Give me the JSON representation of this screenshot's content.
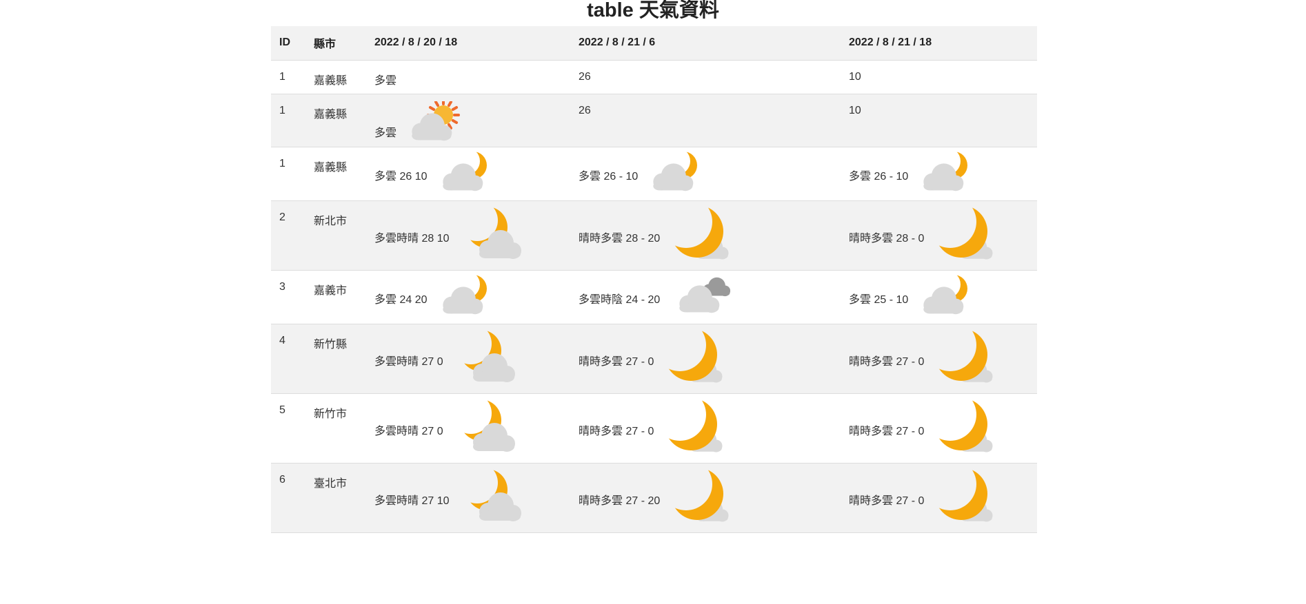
{
  "title": {
    "bold": "table",
    "rest": " 天氣資料"
  },
  "headers": [
    "ID",
    "縣市",
    "2022 / 8 / 20 / 18",
    "2022 / 8 / 21 / 6",
    "2022 / 8 / 21 / 18"
  ],
  "rows": [
    {
      "id": "1",
      "city": "嘉義縣",
      "c1": "多雲",
      "c2": "26",
      "c3": "10",
      "icons": [
        "",
        "",
        ""
      ]
    },
    {
      "id": "1",
      "city": "嘉義縣",
      "c1": "多雲",
      "c2": "26",
      "c3": "10",
      "icons": [
        "sun-behind-cloud-icon",
        "",
        ""
      ]
    },
    {
      "id": "1",
      "city": "嘉義縣",
      "c1": "多雲 26 10",
      "c2": "多雲 26 - 10",
      "c3": "多雲 26 - 10",
      "icons": [
        "cloudy-night-icon",
        "cloudy-night-icon",
        "cloudy-night-icon"
      ]
    },
    {
      "id": "2",
      "city": "新北市",
      "c1": "多雲時晴 28 10",
      "c2": "晴時多雲 28 - 20",
      "c3": "晴時多雲 28 - 0",
      "icons": [
        "partly-cloudy-night-icon",
        "mostly-clear-night-icon",
        "mostly-clear-night-icon"
      ]
    },
    {
      "id": "3",
      "city": "嘉義市",
      "c1": "多雲 24 20",
      "c2": "多雲時陰 24 - 20",
      "c3": "多雲 25 - 10",
      "icons": [
        "cloudy-night-icon",
        "overcast-clouds-icon",
        "cloudy-night-icon"
      ]
    },
    {
      "id": "4",
      "city": "新竹縣",
      "c1": "多雲時晴 27 0",
      "c2": "晴時多雲 27 - 0",
      "c3": "晴時多雲 27 - 0",
      "icons": [
        "partly-cloudy-night-icon",
        "mostly-clear-night-icon",
        "mostly-clear-night-icon"
      ]
    },
    {
      "id": "5",
      "city": "新竹市",
      "c1": "多雲時晴 27 0",
      "c2": "晴時多雲 27 - 0",
      "c3": "晴時多雲 27 - 0",
      "icons": [
        "partly-cloudy-night-icon",
        "mostly-clear-night-icon",
        "mostly-clear-night-icon"
      ]
    },
    {
      "id": "6",
      "city": "臺北市",
      "c1": "多雲時晴 27 10",
      "c2": "晴時多雲 27 - 20",
      "c3": "晴時多雲 27 - 0",
      "icons": [
        "partly-cloudy-night-icon",
        "mostly-clear-night-icon",
        "mostly-clear-night-icon"
      ]
    }
  ],
  "colors": {
    "moon": "#f6a80c",
    "sun": "#f7b733",
    "sun_rays": "#ee6a2d",
    "cloud": "#d9d9d9",
    "dark_cloud": "#9a9a9a",
    "stripe": "#f2f2f2"
  }
}
